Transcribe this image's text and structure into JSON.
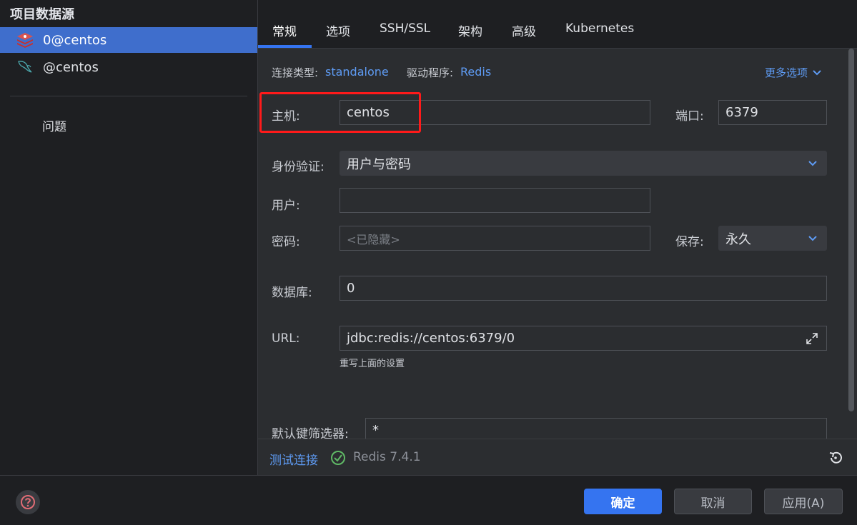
{
  "sidebar": {
    "title": "项目数据源",
    "items": [
      {
        "label": "0@centos",
        "icon": "redis-icon",
        "selected": true
      },
      {
        "label": "@centos",
        "icon": "mysql-dolphin-icon",
        "selected": false
      }
    ],
    "problems_label": "问题"
  },
  "tabs": [
    {
      "label": "常规",
      "active": true
    },
    {
      "label": "选项"
    },
    {
      "label": "SSH/SSL"
    },
    {
      "label": "架构"
    },
    {
      "label": "高级"
    },
    {
      "label": "Kubernetes"
    }
  ],
  "general": {
    "conn_type_label": "连接类型:",
    "conn_type_value": "standalone",
    "driver_label": "驱动程序:",
    "driver_value": "Redis",
    "more_options": "更多选项",
    "host_label": "主机:",
    "host_value": "centos",
    "port_label": "端口:",
    "port_value": "6379",
    "auth_label": "身份验证:",
    "auth_value": "用户与密码",
    "user_label": "用户:",
    "user_value": "",
    "password_label": "密码:",
    "password_placeholder": "<已隐藏>",
    "save_label": "保存:",
    "save_value": "永久",
    "database_label": "数据库:",
    "database_value": "0",
    "url_label": "URL:",
    "url_value": "jdbc:redis://centos:6379/0",
    "url_hint": "重写上面的设置",
    "key_filter_label": "默认键筛选器:",
    "key_filter_value": "*"
  },
  "footer": {
    "test_connection": "测试连接",
    "status": "Redis 7.4.1",
    "colors": {
      "accent": "#3574f0",
      "link": "#5e9bf3",
      "success": "#5fb865",
      "highlight_box": "#ff1a1a"
    }
  },
  "buttons": {
    "ok": "确定",
    "cancel": "取消",
    "apply": "应用(A)"
  }
}
